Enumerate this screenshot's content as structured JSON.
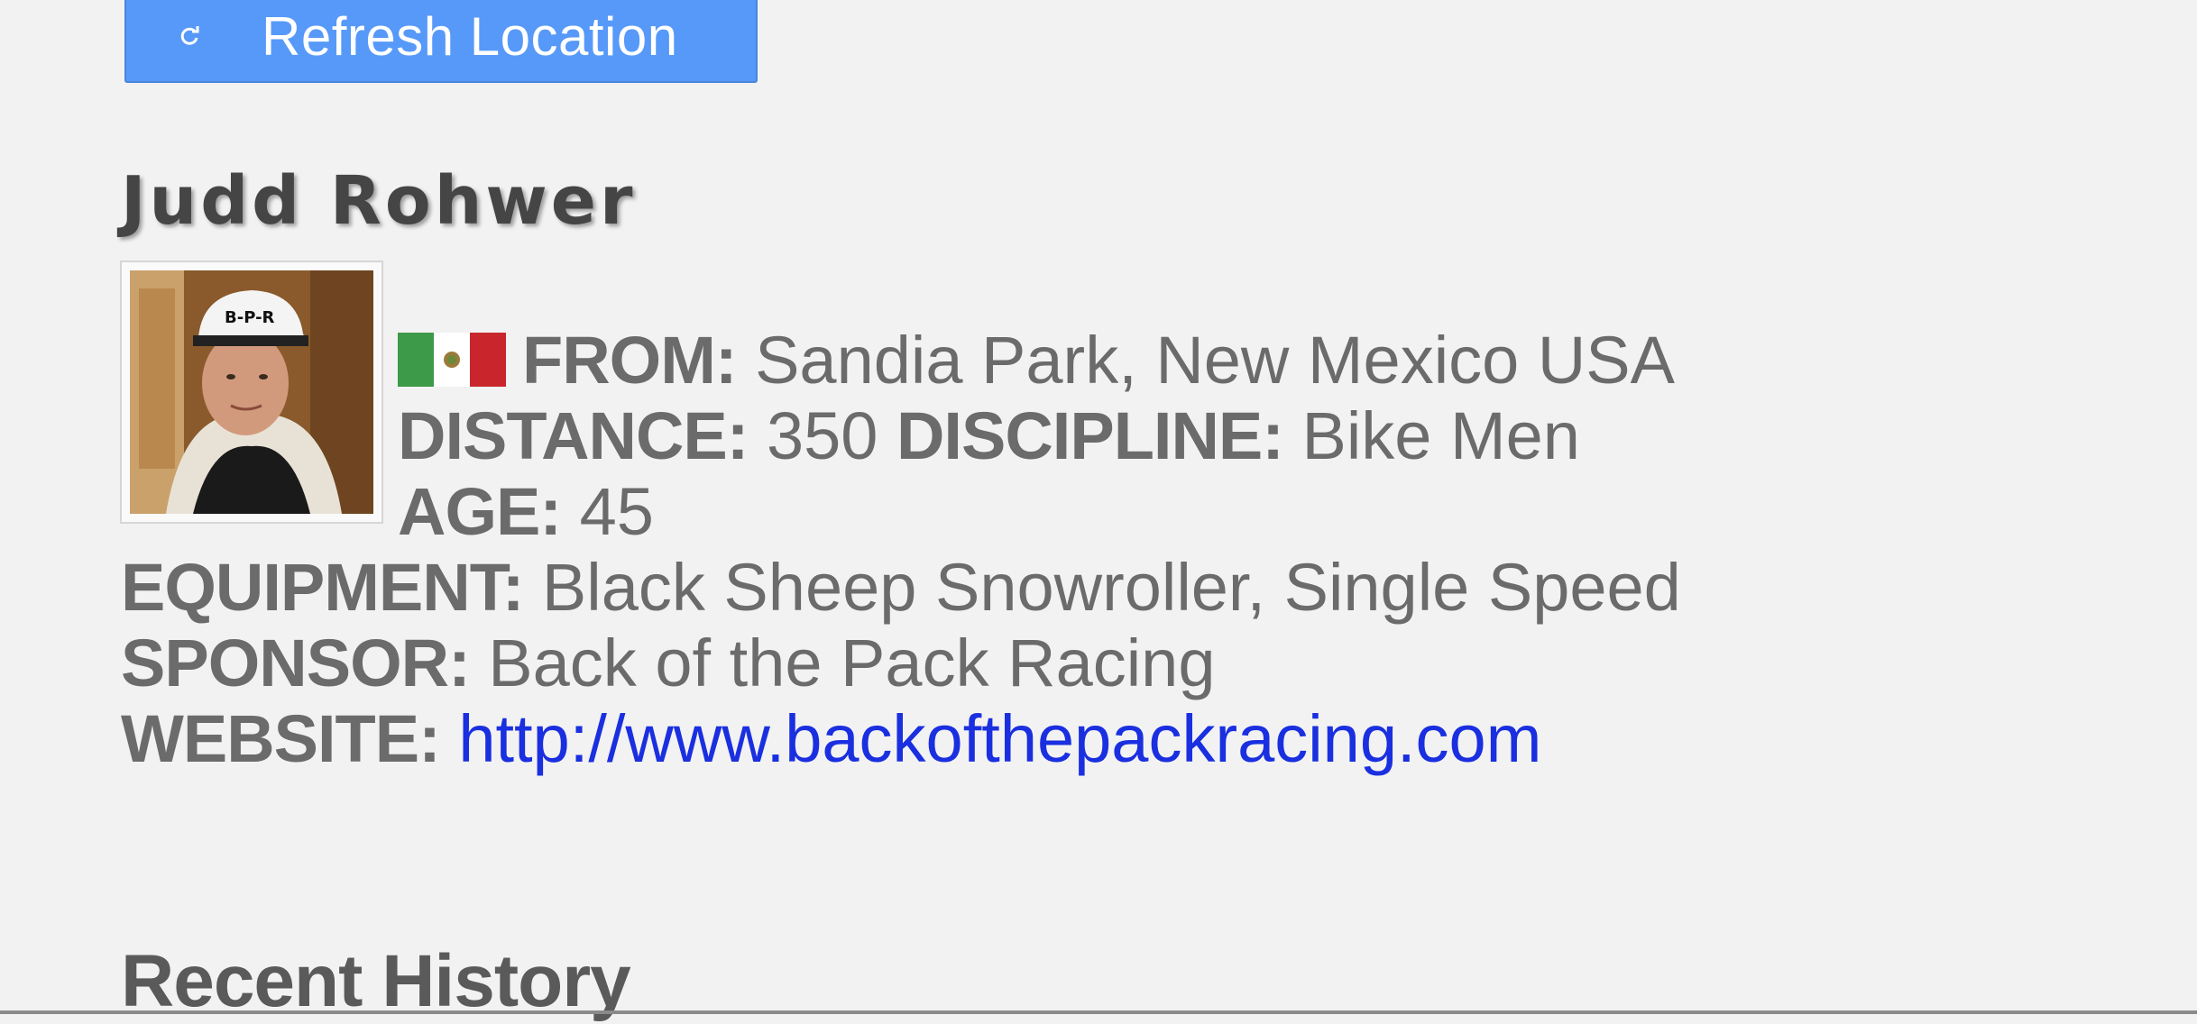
{
  "toolbar": {
    "refresh_label": "Refresh Location",
    "refresh_icon": "refresh-icon"
  },
  "racer": {
    "name": "Judd Rohwer",
    "photo_icon": "racer-photo",
    "flag_icon": "mexico-flag-icon",
    "from_label": "FROM:",
    "from_value": "Sandia Park, New Mexico USA",
    "distance_label": "DISTANCE:",
    "distance_value": "350",
    "discipline_label": "DISCIPLINE:",
    "discipline_value": "Bike Men",
    "age_label": "AGE:",
    "age_value": "45",
    "equipment_label": "EQUIPMENT:",
    "equipment_value": "Black Sheep Snowroller, Single Speed",
    "sponsor_label": "SPONSOR:",
    "sponsor_value": "Back of the Pack Racing",
    "website_label": "WEBSITE:",
    "website_value": "http://www.backofthepackracing.com"
  },
  "history": {
    "title": "Recent History"
  },
  "colors": {
    "background": "#f2f2f2",
    "button": "#5799f8",
    "text": "#6b6b6b",
    "link": "#1a2fe0"
  }
}
